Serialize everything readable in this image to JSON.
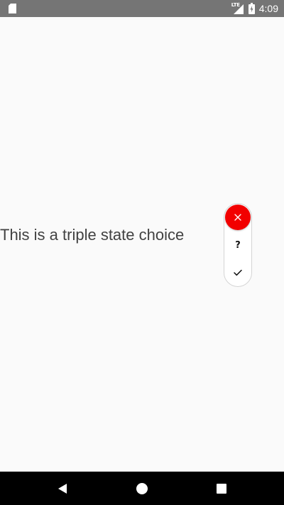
{
  "status_bar": {
    "network_label": "LTE",
    "time": "4:09",
    "icons": [
      "sd-card-icon",
      "signal-icon",
      "battery-charging-icon"
    ]
  },
  "content": {
    "label": "This is a triple state choice"
  },
  "triple_state": {
    "options": [
      {
        "state": "no",
        "icon": "close-icon",
        "selected": true
      },
      {
        "state": "unknown",
        "glyph": "?",
        "selected": false
      },
      {
        "state": "yes",
        "icon": "check-icon",
        "selected": false
      }
    ],
    "selected_color": "#f20000"
  },
  "nav_bar": {
    "icons": [
      "back-icon",
      "home-icon",
      "recent-apps-icon"
    ]
  }
}
